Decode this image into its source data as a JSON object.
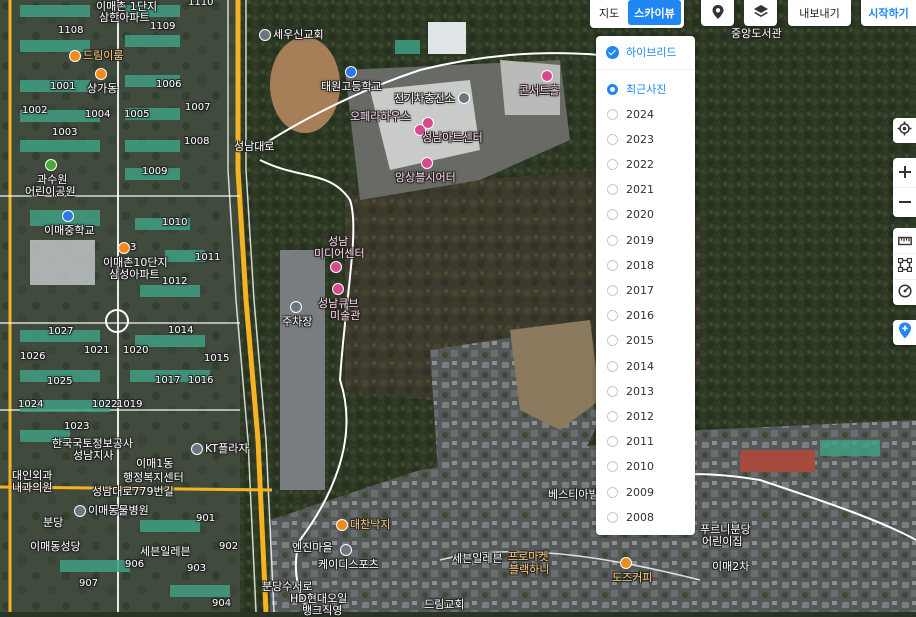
{
  "map": {
    "labels": [
      {
        "id": "a1",
        "text": "이매촌 1단지",
        "color": "w",
        "poi": null
      },
      {
        "id": "a2",
        "text": "삼한아파트",
        "color": "w",
        "poi": null
      },
      {
        "id": "a3",
        "text": "1110",
        "color": "w",
        "poi": null
      },
      {
        "id": "a4",
        "text": "1108",
        "color": "w",
        "poi": null
      },
      {
        "id": "a5",
        "text": "1109",
        "color": "w",
        "poi": null
      },
      {
        "id": "a6",
        "text": "드림이룸",
        "color": "orange",
        "poi": "orange"
      },
      {
        "id": "a7",
        "text": "상가동",
        "color": "w",
        "poi": "orange"
      },
      {
        "id": "a8",
        "text": "1001",
        "color": "w",
        "poi": null
      },
      {
        "id": "a9",
        "text": "1006",
        "color": "w",
        "poi": null
      },
      {
        "id": "a10",
        "text": "1002",
        "color": "w",
        "poi": null
      },
      {
        "id": "a11",
        "text": "1004",
        "color": "w",
        "poi": null
      },
      {
        "id": "a12",
        "text": "1005",
        "color": "w",
        "poi": null
      },
      {
        "id": "a13",
        "text": "1007",
        "color": "w",
        "poi": null
      },
      {
        "id": "a14",
        "text": "1003",
        "color": "w",
        "poi": null
      },
      {
        "id": "a15",
        "text": "1008",
        "color": "w",
        "poi": null
      },
      {
        "id": "a16",
        "text": "1009",
        "color": "w",
        "poi": null
      },
      {
        "id": "a17",
        "text": "과수원",
        "color": "w",
        "poi": "green"
      },
      {
        "id": "a18",
        "text": "어린이공원",
        "color": "w",
        "poi": null
      },
      {
        "id": "a19",
        "text": "이매중학교",
        "color": "w",
        "poi": "blue"
      },
      {
        "id": "a20",
        "text": "1010",
        "color": "w",
        "poi": null
      },
      {
        "id": "a21",
        "text": "3",
        "color": "w",
        "poi": "orange"
      },
      {
        "id": "a22",
        "text": "이매촌10단지",
        "color": "w",
        "poi": null
      },
      {
        "id": "a23",
        "text": "삼성아파트",
        "color": "w",
        "poi": null
      },
      {
        "id": "a24",
        "text": "1011",
        "color": "w",
        "poi": null
      },
      {
        "id": "a25",
        "text": "1012",
        "color": "w",
        "poi": null
      },
      {
        "id": "a26",
        "text": "1027",
        "color": "w",
        "poi": null
      },
      {
        "id": "a27",
        "text": "1014",
        "color": "w",
        "poi": null
      },
      {
        "id": "a28",
        "text": "1021",
        "color": "w",
        "poi": null
      },
      {
        "id": "a29",
        "text": "1020",
        "color": "w",
        "poi": null
      },
      {
        "id": "a30",
        "text": "1026",
        "color": "w",
        "poi": null
      },
      {
        "id": "a31",
        "text": "1015",
        "color": "w",
        "poi": null
      },
      {
        "id": "a32",
        "text": "1025",
        "color": "w",
        "poi": null
      },
      {
        "id": "a33",
        "text": "1017",
        "color": "w",
        "poi": null
      },
      {
        "id": "a34",
        "text": "1016",
        "color": "w",
        "poi": null
      },
      {
        "id": "a35",
        "text": "1024",
        "color": "w",
        "poi": null
      },
      {
        "id": "a36",
        "text": "1022",
        "color": "w",
        "poi": null
      },
      {
        "id": "a37",
        "text": "1019",
        "color": "w",
        "poi": null
      },
      {
        "id": "a38",
        "text": "1023",
        "color": "w",
        "poi": null
      },
      {
        "id": "a39",
        "text": "한국국토정보공사",
        "color": "w",
        "poi": null
      },
      {
        "id": "a40",
        "text": "성남지사",
        "color": "w",
        "poi": null
      },
      {
        "id": "a41",
        "text": "이매1동",
        "color": "w",
        "poi": null
      },
      {
        "id": "a42",
        "text": "행정복지센터",
        "color": "w",
        "poi": null
      },
      {
        "id": "a43",
        "text": "KT플라자",
        "color": "w",
        "poi": "gray"
      },
      {
        "id": "a44",
        "text": "대인외과",
        "color": "w",
        "poi": null
      },
      {
        "id": "a45",
        "text": "내과의원",
        "color": "w",
        "poi": null
      },
      {
        "id": "a46",
        "text": "성남대로779번길",
        "color": "w",
        "poi": null
      },
      {
        "id": "a47",
        "text": "이매동물병원",
        "color": "w",
        "poi": "gray"
      },
      {
        "id": "a48",
        "text": "분당",
        "color": "w",
        "poi": null
      },
      {
        "id": "a49",
        "text": "이매동성당",
        "color": "w",
        "poi": null
      },
      {
        "id": "a50",
        "text": "901",
        "color": "w",
        "poi": null
      },
      {
        "id": "a51",
        "text": "902",
        "color": "w",
        "poi": null
      },
      {
        "id": "a52",
        "text": "세븐일레븐",
        "color": "w",
        "poi": null
      },
      {
        "id": "a53",
        "text": "906",
        "color": "w",
        "poi": null
      },
      {
        "id": "a54",
        "text": "903",
        "color": "w",
        "poi": null
      },
      {
        "id": "a55",
        "text": "907",
        "color": "w",
        "poi": null
      },
      {
        "id": "a56",
        "text": "904",
        "color": "w",
        "poi": null
      },
      {
        "id": "a57",
        "text": "세우신교회",
        "color": "w",
        "poi": "gray"
      },
      {
        "id": "a58",
        "text": "태원고등학교",
        "color": "w",
        "poi": "blue"
      },
      {
        "id": "a59",
        "text": "전기차충전소",
        "color": "w",
        "poi": "gray"
      },
      {
        "id": "a60",
        "text": "콘서트홀",
        "color": "pink",
        "poi": "pink"
      },
      {
        "id": "a61",
        "text": "오페라하우스",
        "color": "pink",
        "poi": "pink"
      },
      {
        "id": "a62",
        "text": "성남아트센터",
        "color": "pink",
        "poi": "pink"
      },
      {
        "id": "a63",
        "text": "앙상블시어터",
        "color": "pink",
        "poi": "pink"
      },
      {
        "id": "a64",
        "text": "성남",
        "color": "pink",
        "poi": null
      },
      {
        "id": "a65",
        "text": "미디어센터",
        "color": "pink",
        "poi": "pink"
      },
      {
        "id": "a66",
        "text": "성남큐브",
        "color": "pink",
        "poi": "pink"
      },
      {
        "id": "a67",
        "text": "미술관",
        "color": "pink",
        "poi": null
      },
      {
        "id": "a68",
        "text": "주차장",
        "color": "w",
        "poi": "gray"
      },
      {
        "id": "a69",
        "text": "대찬낙지",
        "color": "orange",
        "poi": "orange"
      },
      {
        "id": "a70",
        "text": "엔진마을",
        "color": "w",
        "poi": null
      },
      {
        "id": "a71",
        "text": "케이디스포츠",
        "color": "w",
        "poi": "gray"
      },
      {
        "id": "a72",
        "text": "HD현대오일",
        "color": "w",
        "poi": null
      },
      {
        "id": "a73",
        "text": "뱅크직영",
        "color": "w",
        "poi": null
      },
      {
        "id": "a74",
        "text": "드림교회",
        "color": "w",
        "poi": null
      },
      {
        "id": "a75",
        "text": "세븐일레븐",
        "color": "w",
        "poi": null
      },
      {
        "id": "a76",
        "text": "베스티아빌",
        "color": "w",
        "poi": null
      },
      {
        "id": "a77",
        "text": "프로마켓",
        "color": "orange",
        "poi": null
      },
      {
        "id": "a78",
        "text": "블랙하니",
        "color": "orange",
        "poi": null
      },
      {
        "id": "a79",
        "text": "도즈커피",
        "color": "orange",
        "poi": "orange"
      },
      {
        "id": "a80",
        "text": "푸르니분당",
        "color": "w",
        "poi": null
      },
      {
        "id": "a81",
        "text": "어린이집",
        "color": "w",
        "poi": null
      },
      {
        "id": "a82",
        "text": "이매2차",
        "color": "w",
        "poi": null
      },
      {
        "id": "a83",
        "text": "중앙도서관",
        "color": "w",
        "poi": null
      },
      {
        "id": "a84",
        "text": "성남대로",
        "color": "w",
        "poi": null
      },
      {
        "id": "a85",
        "text": "분당수서로",
        "color": "w",
        "poi": null
      }
    ]
  },
  "toolbar": {
    "map_label": "지도",
    "skyview_label": "스카이뷰",
    "export_label": "내보내기",
    "start_label": "시작하기"
  },
  "photo_menu": {
    "hybrid_label": "하이브리드",
    "latest_label": "최근사진",
    "years": [
      "2024",
      "2023",
      "2022",
      "2021",
      "2020",
      "2019",
      "2018",
      "2017",
      "2016",
      "2015",
      "2014",
      "2013",
      "2012",
      "2011",
      "2010",
      "2009",
      "2008"
    ]
  },
  "icons": {
    "pin": "location-pin-icon",
    "layers": "layers-icon",
    "locate": "locate-me-icon",
    "zoom_in": "zoom-in-icon",
    "zoom_out": "zoom-out-icon",
    "ruler": "ruler-icon",
    "area": "area-measure-icon",
    "radius": "radius-measure-icon",
    "place": "add-place-icon"
  },
  "colors": {
    "accent": "#1f86f2",
    "expressway": "#f5b324",
    "road": "#ffffff",
    "forest": "#2f3a26"
  }
}
